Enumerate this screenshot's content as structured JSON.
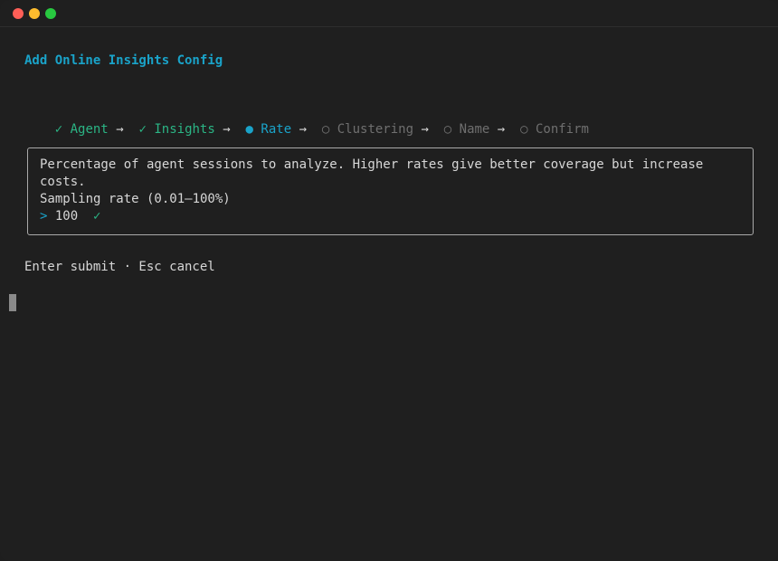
{
  "window": {
    "traffic_lights": [
      "close",
      "minimize",
      "zoom"
    ]
  },
  "heading": "Add Online Insights Config",
  "steps": [
    {
      "marker": "✓",
      "label": "Agent",
      "state": "done"
    },
    {
      "marker": "✓",
      "label": "Insights",
      "state": "done"
    },
    {
      "marker": "●",
      "label": "Rate",
      "state": "current"
    },
    {
      "marker": "○",
      "label": "Clustering",
      "state": "pending"
    },
    {
      "marker": "○",
      "label": "Name",
      "state": "pending"
    },
    {
      "marker": "○",
      "label": "Confirm",
      "state": "pending"
    }
  ],
  "step_separator": "→",
  "panel": {
    "description_line1": "Percentage of agent sessions to analyze. Higher rates give better coverage but increase",
    "description_line2": "costs.",
    "field_label": "Sampling rate (0.01–100%)",
    "prompt_symbol": ">",
    "input_value": "100",
    "valid_mark": "✓"
  },
  "hint": "Enter submit · Esc cancel",
  "colors": {
    "accent": "#1aa3c9",
    "done": "#2bb585",
    "pending": "#6f6f6f",
    "text": "#d7d7d7",
    "background": "#1f1f1f"
  }
}
